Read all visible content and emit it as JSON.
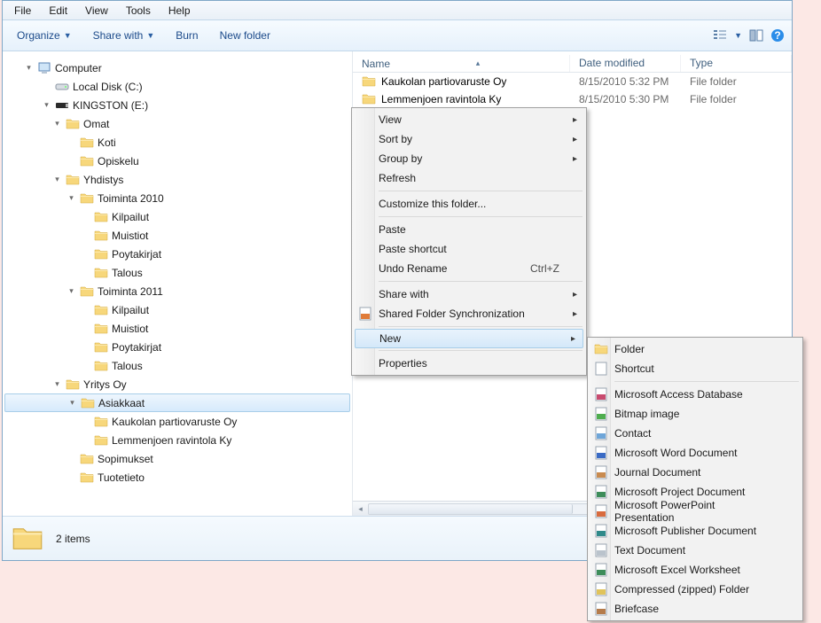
{
  "menubar": [
    "File",
    "Edit",
    "View",
    "Tools",
    "Help"
  ],
  "toolbar": {
    "organize": "Organize",
    "share": "Share with",
    "burn": "Burn",
    "newfolder": "New folder"
  },
  "columns": {
    "name": "Name",
    "date": "Date modified",
    "type": "Type"
  },
  "tree": [
    {
      "label": "Computer",
      "icon": "computer",
      "indent": 22,
      "exp": "▾"
    },
    {
      "label": "Local Disk (C:)",
      "icon": "disk",
      "indent": 42,
      "exp": ""
    },
    {
      "label": "KINGSTON (E:)",
      "icon": "usb",
      "indent": 42,
      "exp": "▾"
    },
    {
      "label": "Omat",
      "icon": "folder",
      "indent": 54,
      "exp": "▾"
    },
    {
      "label": "Koti",
      "icon": "folder",
      "indent": 70,
      "exp": ""
    },
    {
      "label": "Opiskelu",
      "icon": "folder",
      "indent": 70,
      "exp": ""
    },
    {
      "label": "Yhdistys",
      "icon": "folder",
      "indent": 54,
      "exp": "▾"
    },
    {
      "label": "Toiminta 2010",
      "icon": "folder",
      "indent": 70,
      "exp": "▾"
    },
    {
      "label": "Kilpailut",
      "icon": "folder",
      "indent": 86,
      "exp": ""
    },
    {
      "label": "Muistiot",
      "icon": "folder",
      "indent": 86,
      "exp": ""
    },
    {
      "label": "Poytakirjat",
      "icon": "folder",
      "indent": 86,
      "exp": ""
    },
    {
      "label": "Talous",
      "icon": "folder",
      "indent": 86,
      "exp": ""
    },
    {
      "label": "Toiminta 2011",
      "icon": "folder",
      "indent": 70,
      "exp": "▾"
    },
    {
      "label": "Kilpailut",
      "icon": "folder",
      "indent": 86,
      "exp": ""
    },
    {
      "label": "Muistiot",
      "icon": "folder",
      "indent": 86,
      "exp": ""
    },
    {
      "label": "Poytakirjat",
      "icon": "folder",
      "indent": 86,
      "exp": ""
    },
    {
      "label": "Talous",
      "icon": "folder",
      "indent": 86,
      "exp": ""
    },
    {
      "label": "Yritys Oy",
      "icon": "folder",
      "indent": 54,
      "exp": "▾"
    },
    {
      "label": "Asiakkaat",
      "icon": "folder",
      "indent": 70,
      "exp": "▾",
      "selected": true
    },
    {
      "label": "Kaukolan partiovaruste Oy",
      "icon": "folder",
      "indent": 86,
      "exp": ""
    },
    {
      "label": "Lemmenjoen ravintola Ky",
      "icon": "folder",
      "indent": 86,
      "exp": ""
    },
    {
      "label": "Sopimukset",
      "icon": "folder",
      "indent": 70,
      "exp": ""
    },
    {
      "label": "Tuotetieto",
      "icon": "folder",
      "indent": 70,
      "exp": ""
    }
  ],
  "rows": [
    {
      "name": "Kaukolan partiovaruste Oy",
      "date": "8/15/2010 5:32 PM",
      "type": "File folder"
    },
    {
      "name": "Lemmenjoen ravintola Ky",
      "date": "8/15/2010 5:30 PM",
      "type": "File folder"
    }
  ],
  "status": {
    "count": "2 items"
  },
  "context_main": [
    {
      "label": "View",
      "sub": true
    },
    {
      "label": "Sort by",
      "sub": true
    },
    {
      "label": "Group by",
      "sub": true
    },
    {
      "label": "Refresh"
    },
    {
      "sep": true
    },
    {
      "label": "Customize this folder..."
    },
    {
      "sep": true
    },
    {
      "label": "Paste"
    },
    {
      "label": "Paste shortcut"
    },
    {
      "label": "Undo Rename",
      "accel": "Ctrl+Z"
    },
    {
      "sep": true
    },
    {
      "label": "Share with",
      "sub": true
    },
    {
      "label": "Shared Folder Synchronization",
      "sub": true,
      "icon": "sync"
    },
    {
      "sep": true
    },
    {
      "label": "New",
      "sub": true,
      "highlight": true
    },
    {
      "sep": true
    },
    {
      "label": "Properties"
    }
  ],
  "context_new": [
    {
      "label": "Folder",
      "icon": "folder"
    },
    {
      "label": "Shortcut",
      "icon": "shortcut"
    },
    {
      "sep": true
    },
    {
      "label": "Microsoft Access Database",
      "icon": "access"
    },
    {
      "label": "Bitmap image",
      "icon": "bitmap"
    },
    {
      "label": "Contact",
      "icon": "contact"
    },
    {
      "label": "Microsoft Word Document",
      "icon": "word"
    },
    {
      "label": "Journal Document",
      "icon": "journal"
    },
    {
      "label": "Microsoft Project Document",
      "icon": "project"
    },
    {
      "label": "Microsoft PowerPoint Presentation",
      "icon": "ppt"
    },
    {
      "label": "Microsoft Publisher Document",
      "icon": "publisher"
    },
    {
      "label": "Text Document",
      "icon": "text"
    },
    {
      "label": "Microsoft Excel Worksheet",
      "icon": "excel"
    },
    {
      "label": "Compressed (zipped) Folder",
      "icon": "zip"
    },
    {
      "label": "Briefcase",
      "icon": "briefcase"
    }
  ]
}
